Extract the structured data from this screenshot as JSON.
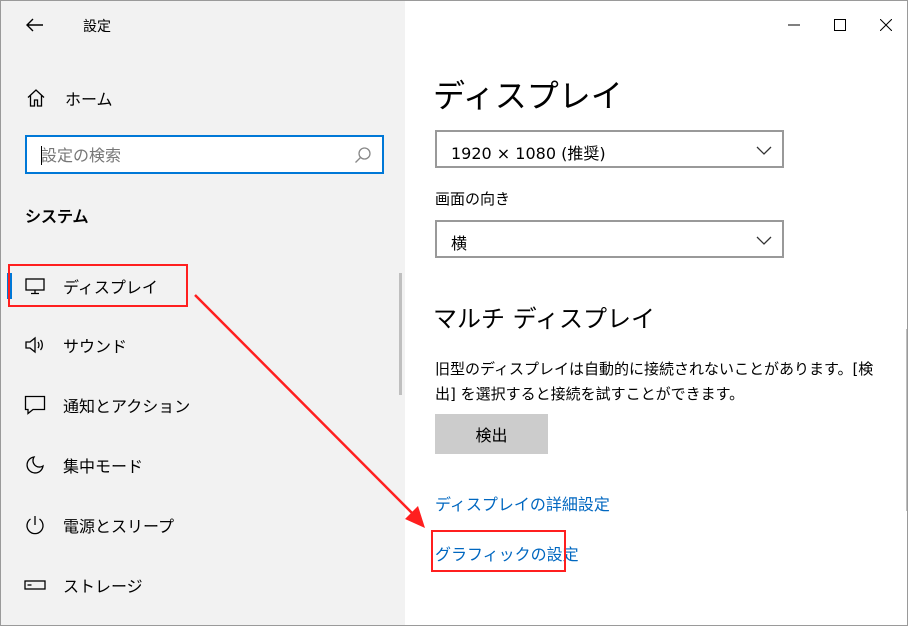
{
  "window": {
    "app_title": "設定"
  },
  "nav": {
    "home_label": "ホーム",
    "search_placeholder": "設定の検索",
    "section_heading": "システム",
    "items": [
      {
        "label": "ディスプレイ",
        "icon": "monitor-icon",
        "active": true
      },
      {
        "label": "サウンド",
        "icon": "speaker-icon",
        "active": false
      },
      {
        "label": "通知とアクション",
        "icon": "notification-icon",
        "active": false
      },
      {
        "label": "集中モード",
        "icon": "moon-icon",
        "active": false
      },
      {
        "label": "電源とスリープ",
        "icon": "power-icon",
        "active": false
      },
      {
        "label": "ストレージ",
        "icon": "storage-icon",
        "active": false
      }
    ]
  },
  "content": {
    "page_title": "ディスプレイ",
    "resolution_value": "1920 × 1080 (推奨)",
    "orientation_label": "画面の向き",
    "orientation_value": "横",
    "multi_display_title": "マルチ ディスプレイ",
    "multi_display_description": "旧型のディスプレイは自動的に接続されないことがあります。[検出] を選択すると接続を試すことができます。",
    "detect_button": "検出",
    "advanced_link": "ディスプレイの詳細設定",
    "graphics_link": "グラフィックの設定"
  },
  "colors": {
    "accent": "#0078d7",
    "link": "#0067c0",
    "annotation": "#ff1f1f",
    "nav_background": "#f2f2f2"
  }
}
